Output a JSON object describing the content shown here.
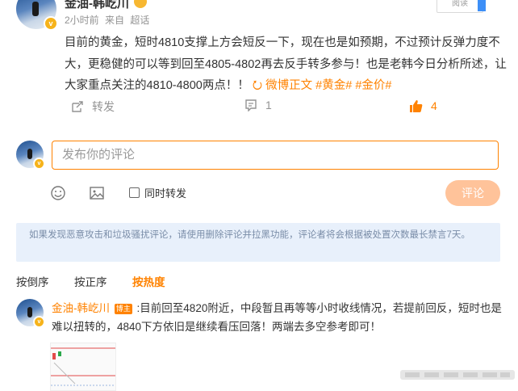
{
  "post": {
    "author": "金油-韩屹川",
    "meta": {
      "time": "2小时前",
      "source": "来自",
      "device": "超话"
    },
    "read_tag": "阅读",
    "text_main": "目前的黄金，短时4810支撑上方会短反一下，现在也是如预期，不过预计反弹力度不大，更稳健的可以等到回至4805-4802再去反手转多参与！也是老韩今日分析所述，让大家重点关注的4810-4800两点！！",
    "link_weibo": "微博正文",
    "tags": [
      "#黄金#",
      "#金价#"
    ]
  },
  "actions": {
    "forward_label": "转发",
    "comment_count": "1",
    "like_count": "4"
  },
  "composer": {
    "placeholder": "发布你的评论",
    "repost_label": "同时转发",
    "submit_label": "评论"
  },
  "notice": "如果发现恶意攻击和垃圾骚扰评论，请使用删除评论并拉黑功能，评论者将会根据被处置次数最长禁言7天。",
  "sort_tabs": [
    "按倒序",
    "按正序",
    "按热度"
  ],
  "comment": {
    "author": "金油-韩屹川",
    "badge": "博主",
    "text": ":目前回至4820附近，中段暂且再等等小时收线情况，若提前回反，短时也是难以扭转的，4840下方依旧是继续看压回落！两端去多空参考即可！"
  },
  "colors": {
    "accent": "#ff8200",
    "submit_disabled": "#ffc39a",
    "notice_bg": "#e8f0fb"
  }
}
